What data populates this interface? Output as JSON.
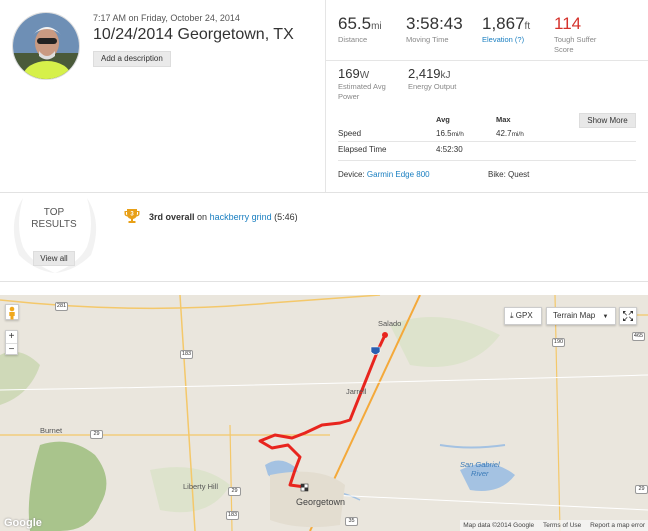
{
  "activity": {
    "datetime": "7:17 AM on Friday, October 24, 2014",
    "title": "10/24/2014 Georgetown, TX",
    "add_description": "Add a description"
  },
  "stats": {
    "distance": {
      "value": "65.5",
      "unit": "mi",
      "label": "Distance"
    },
    "moving_time": {
      "value": "3:58:43",
      "label": "Moving Time"
    },
    "elevation": {
      "value": "1,867",
      "unit": "ft",
      "label": "Elevation (?)"
    },
    "suffer_score": {
      "value": "114",
      "label_line1": "Tough Suffer",
      "label_line2": "Score"
    },
    "power": {
      "value": "169",
      "unit": "W",
      "label_line1": "Estimated Avg",
      "label_line2": "Power"
    },
    "energy": {
      "value": "2,419",
      "unit": "kJ",
      "label": "Energy Output"
    }
  },
  "table": {
    "col_avg": "Avg",
    "col_max": "Max",
    "show_more": "Show More",
    "speed_label": "Speed",
    "speed_avg": "16.5",
    "speed_max": "42.7",
    "speed_unit": "mi/h",
    "elapsed_label": "Elapsed Time",
    "elapsed_value": "4:52:30"
  },
  "device": {
    "label": "Device:",
    "value": "Garmin Edge 800"
  },
  "bike": {
    "label": "Bike:",
    "value": "Quest"
  },
  "top_results": {
    "heading_line1": "TOP",
    "heading_line2": "RESULTS",
    "view_all": "View all",
    "trophy_rank": "3",
    "item_rank": "3rd overall",
    "item_on": "on",
    "item_segment": "hackberry grind",
    "item_time": "(5:46)"
  },
  "map": {
    "gpx_button": "GPX",
    "map_type": "Terrain Map",
    "zoom_in": "+",
    "zoom_out": "−",
    "places": {
      "salado": "Salado",
      "jarrell": "Jarrell",
      "burnet": "Burnet",
      "liberty_hill": "Liberty Hill",
      "georgetown": "Georgetown",
      "river_line1": "San Gabriel",
      "river_line2": "River"
    },
    "shields": {
      "s281": "281",
      "s183": "183",
      "s183b": "183",
      "s190": "190",
      "s465": "465",
      "s29a": "29",
      "s29b": "29",
      "s29c": "29",
      "s35": "35"
    },
    "attribution": {
      "data": "Map data ©2014 Google",
      "terms": "Terms of Use",
      "report": "Report a map error"
    },
    "logo": "Google",
    "colors": {
      "route": "#e8251e",
      "land": "#eae6dd",
      "forest": "#a9c48c",
      "water": "#a4c2e2"
    }
  },
  "colors": {
    "accent_link": "#1a7fc1",
    "suffer": "#d5312b",
    "trophy": "#e8a018"
  }
}
